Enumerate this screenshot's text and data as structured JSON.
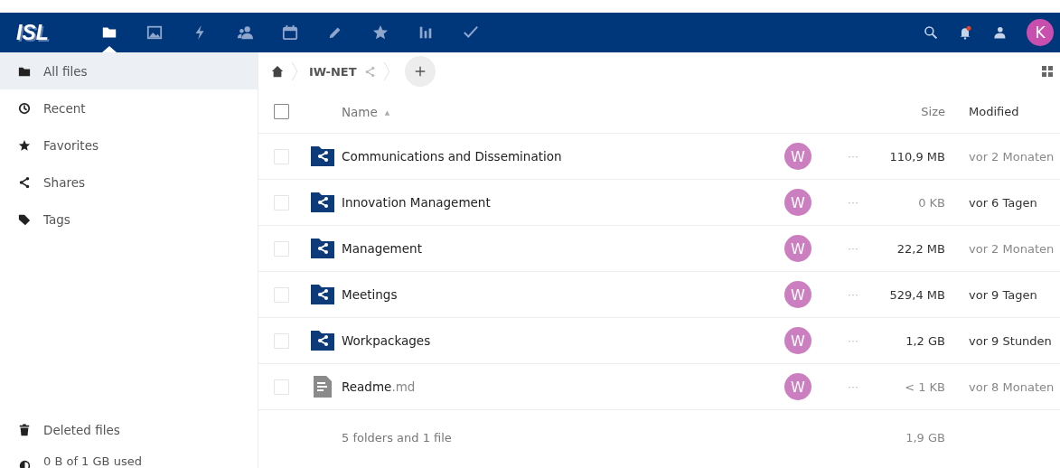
{
  "header": {
    "logo": "ISL",
    "apps": [
      {
        "kind": "files",
        "selected": true
      },
      {
        "kind": "gallery",
        "selected": false
      },
      {
        "kind": "activity",
        "selected": false
      },
      {
        "kind": "contacts",
        "selected": false
      },
      {
        "kind": "calendar",
        "selected": false
      },
      {
        "kind": "notes",
        "selected": false
      },
      {
        "kind": "favorites",
        "selected": false
      },
      {
        "kind": "analytics",
        "selected": false
      },
      {
        "kind": "tasks",
        "selected": false
      }
    ],
    "notifications": {
      "unread": true
    },
    "user_avatar": "K"
  },
  "sidebar": {
    "items": [
      {
        "kind": "folder",
        "label": "All files",
        "selected": true
      },
      {
        "kind": "clock",
        "label": "Recent",
        "selected": false
      },
      {
        "kind": "star",
        "label": "Favorites",
        "selected": false
      },
      {
        "kind": "share",
        "label": "Shares",
        "selected": false
      },
      {
        "kind": "tag",
        "label": "Tags",
        "selected": false
      }
    ],
    "deleted": "Deleted files",
    "quota": "0 B of 1 GB used"
  },
  "breadcrumb": {
    "folder": "IW-NET"
  },
  "table": {
    "select_all": {
      "checked": false
    },
    "columns": {
      "name": "Name",
      "name_sort": "▲",
      "size": "Size",
      "modified": "Modified"
    },
    "rows": [
      {
        "kind": "shared-folder",
        "checked": false,
        "name": "Communications and Dissemination",
        "owner": "W",
        "menu": "···",
        "size": "110,9 MB",
        "size_faded": false,
        "modified": "vor 2 Monaten",
        "modified_faded": true
      },
      {
        "kind": "shared-folder",
        "checked": false,
        "name": "Innovation Management",
        "owner": "W",
        "menu": "···",
        "size": "0 KB",
        "size_faded": true,
        "modified": "vor 6 Tagen",
        "modified_faded": false
      },
      {
        "kind": "shared-folder",
        "checked": false,
        "name": "Management",
        "owner": "W",
        "menu": "···",
        "size": "22,2 MB",
        "size_faded": false,
        "modified": "vor 2 Monaten",
        "modified_faded": true
      },
      {
        "kind": "shared-folder",
        "checked": false,
        "name": "Meetings",
        "owner": "W",
        "menu": "···",
        "size": "529,4 MB",
        "size_faded": false,
        "modified": "vor 9 Tagen",
        "modified_faded": false
      },
      {
        "kind": "shared-folder",
        "checked": false,
        "name": "Workpackages",
        "owner": "W",
        "menu": "···",
        "size": "1,2 GB",
        "size_faded": false,
        "modified": "vor 9 Stunden",
        "modified_faded": false
      },
      {
        "kind": "text-file",
        "checked": false,
        "name": "Readme",
        "extension": ".md",
        "owner": "W",
        "menu": "···",
        "size": "< 1 KB",
        "size_faded": true,
        "modified": "vor 8 Monaten",
        "modified_faded": true
      }
    ],
    "summary": {
      "label": "5 folders and 1 file",
      "size": "1,9 GB"
    }
  }
}
